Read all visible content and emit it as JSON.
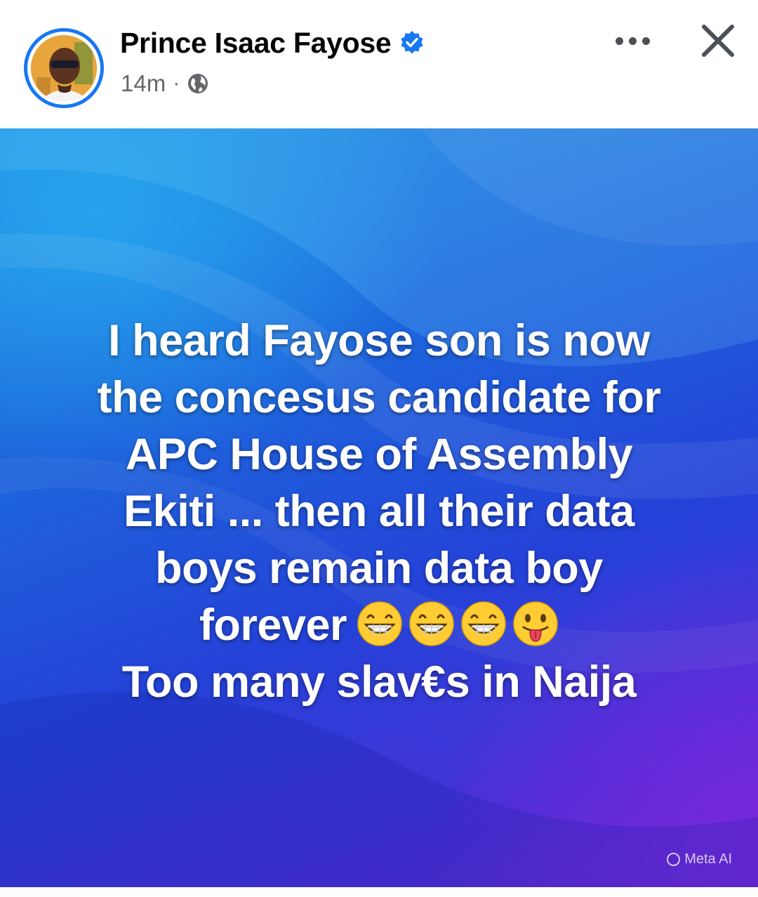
{
  "post": {
    "author": "Prince Isaac Fayose",
    "verified": true,
    "time": "14m",
    "separator": "·",
    "privacy_icon": "globe-icon",
    "text_lines": [
      "I heard Fayose son is now",
      "the concesus candidate for",
      "APC House of Assembly",
      "Ekiti ... then all their data",
      "boys remain data boy",
      "forever",
      "Too many slav€s in Naija"
    ],
    "emojis": [
      "grinning-face-icon",
      "grinning-face-icon",
      "grinning-face-icon",
      "tongue-face-icon"
    ],
    "watermark": "Meta AI"
  },
  "actions": {
    "more_icon": "more-horizontal-icon",
    "close_icon": "close-icon"
  },
  "colors": {
    "accent": "#1877f2",
    "name_text": "#050505",
    "meta_text": "#65676b",
    "background_gradient": [
      "#1f8fe0",
      "#2442d8",
      "#6a2ad0"
    ],
    "post_text": "#ffffff"
  }
}
